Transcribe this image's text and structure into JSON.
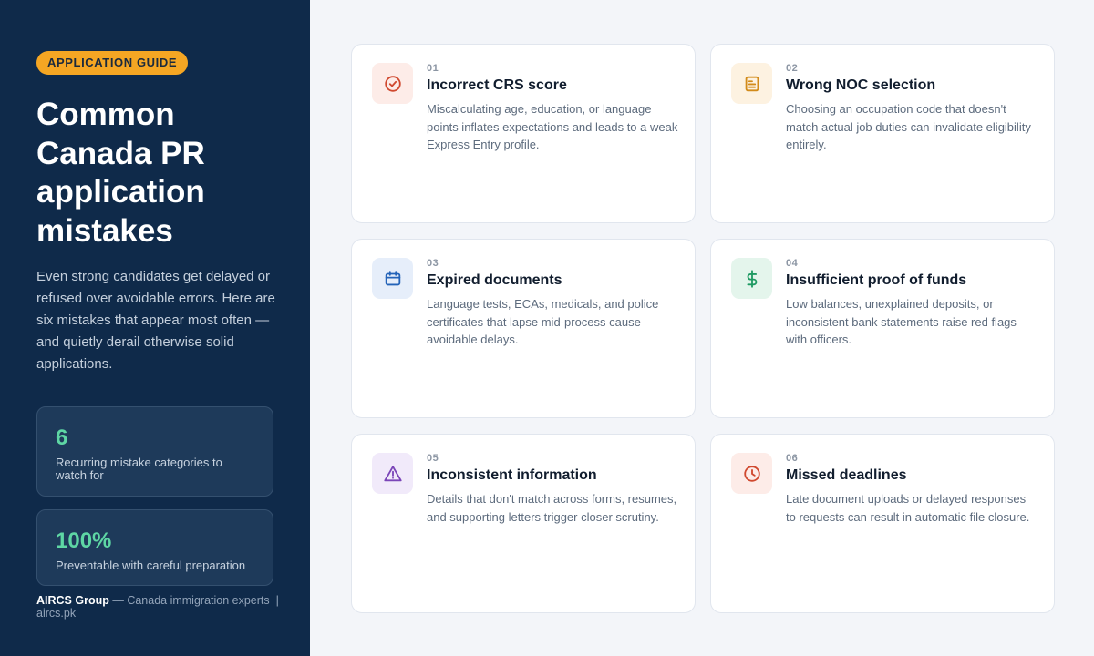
{
  "sidebar": {
    "badge": "APPLICATION GUIDE",
    "title": "Common Canada PR application mistakes",
    "description": "Even strong candidates get delayed or refused over avoidable errors. Here are six mistakes that appear most often — and quietly derail otherwise solid applications.",
    "stats": [
      {
        "value": "6",
        "label": "Recurring mistake categories to watch for"
      },
      {
        "value": "100%",
        "label": "Preventable with careful preparation"
      }
    ],
    "footer": {
      "brand": "AIRCS Group",
      "tagline": "— Canada immigration experts",
      "separator": "|",
      "site": "aircs.pk"
    }
  },
  "cards": [
    {
      "number": "01",
      "title": "Incorrect CRS score",
      "description": "Miscalculating age, education, or language points inflates expectations and leads to a weak Express Entry profile.",
      "icon": "check-circle-icon",
      "accent": "#d0492f",
      "tint": "#fdece8"
    },
    {
      "number": "02",
      "title": "Wrong NOC selection",
      "description": "Choosing an occupation code that doesn't match actual job duties can invalidate eligibility entirely.",
      "icon": "document-icon",
      "accent": "#d28b1a",
      "tint": "#fdf2e1"
    },
    {
      "number": "03",
      "title": "Expired documents",
      "description": "Language tests, ECAs, medicals, and police certificates that lapse mid-process cause avoidable delays.",
      "icon": "calendar-icon",
      "accent": "#2463b8",
      "tint": "#e6eefa"
    },
    {
      "number": "04",
      "title": "Insufficient proof of funds",
      "description": "Low balances, unexplained deposits, or inconsistent bank statements raise red flags with officers.",
      "icon": "dollar-icon",
      "accent": "#1f9a63",
      "tint": "#e4f5ec"
    },
    {
      "number": "05",
      "title": "Inconsistent information",
      "description": "Details that don't match across forms, resumes, and supporting letters trigger closer scrutiny.",
      "icon": "warning-icon",
      "accent": "#7b46b8",
      "tint": "#f1eafa"
    },
    {
      "number": "06",
      "title": "Missed deadlines",
      "description": "Late document uploads or delayed responses to requests can result in automatic file closure.",
      "icon": "clock-icon",
      "accent": "#d0492f",
      "tint": "#fdece8"
    }
  ]
}
